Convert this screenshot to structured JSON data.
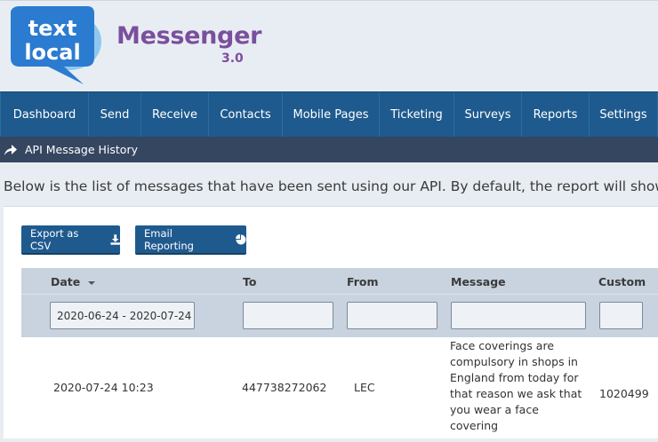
{
  "logo": {
    "line1": "text",
    "line2": "local"
  },
  "brand": {
    "name": "Messenger",
    "version": "3.0"
  },
  "nav": [
    "Dashboard",
    "Send",
    "Receive",
    "Contacts",
    "Mobile Pages",
    "Ticketing",
    "Surveys",
    "Reports",
    "Settings"
  ],
  "subbar": {
    "icon": "share-arrow-icon",
    "title": "API Message History"
  },
  "description": "Below is the list of messages that have been sent using our API. By default, the report will show",
  "buttons": {
    "export_csv": "Export as CSV",
    "email_reporting": "Email Reporting"
  },
  "table": {
    "headers": {
      "date": "Date",
      "to": "To",
      "from": "From",
      "message": "Message",
      "custom": "Custom"
    },
    "filters": {
      "date": "2020-06-24 - 2020-07-24",
      "to": "",
      "from": "",
      "message": "",
      "custom": ""
    },
    "rows": [
      {
        "date": "2020-07-24 10:23",
        "to": "447738272062",
        "from": "LEC",
        "message": "Face coverings are compulsory in shops in England from today for that reason we ask that you wear a face covering",
        "custom": "1020499"
      }
    ]
  },
  "colors": {
    "nav": "#1e5a8e",
    "subbar": "#354660",
    "brand": "#7b4f9d",
    "logo": "#2a7fd4"
  }
}
